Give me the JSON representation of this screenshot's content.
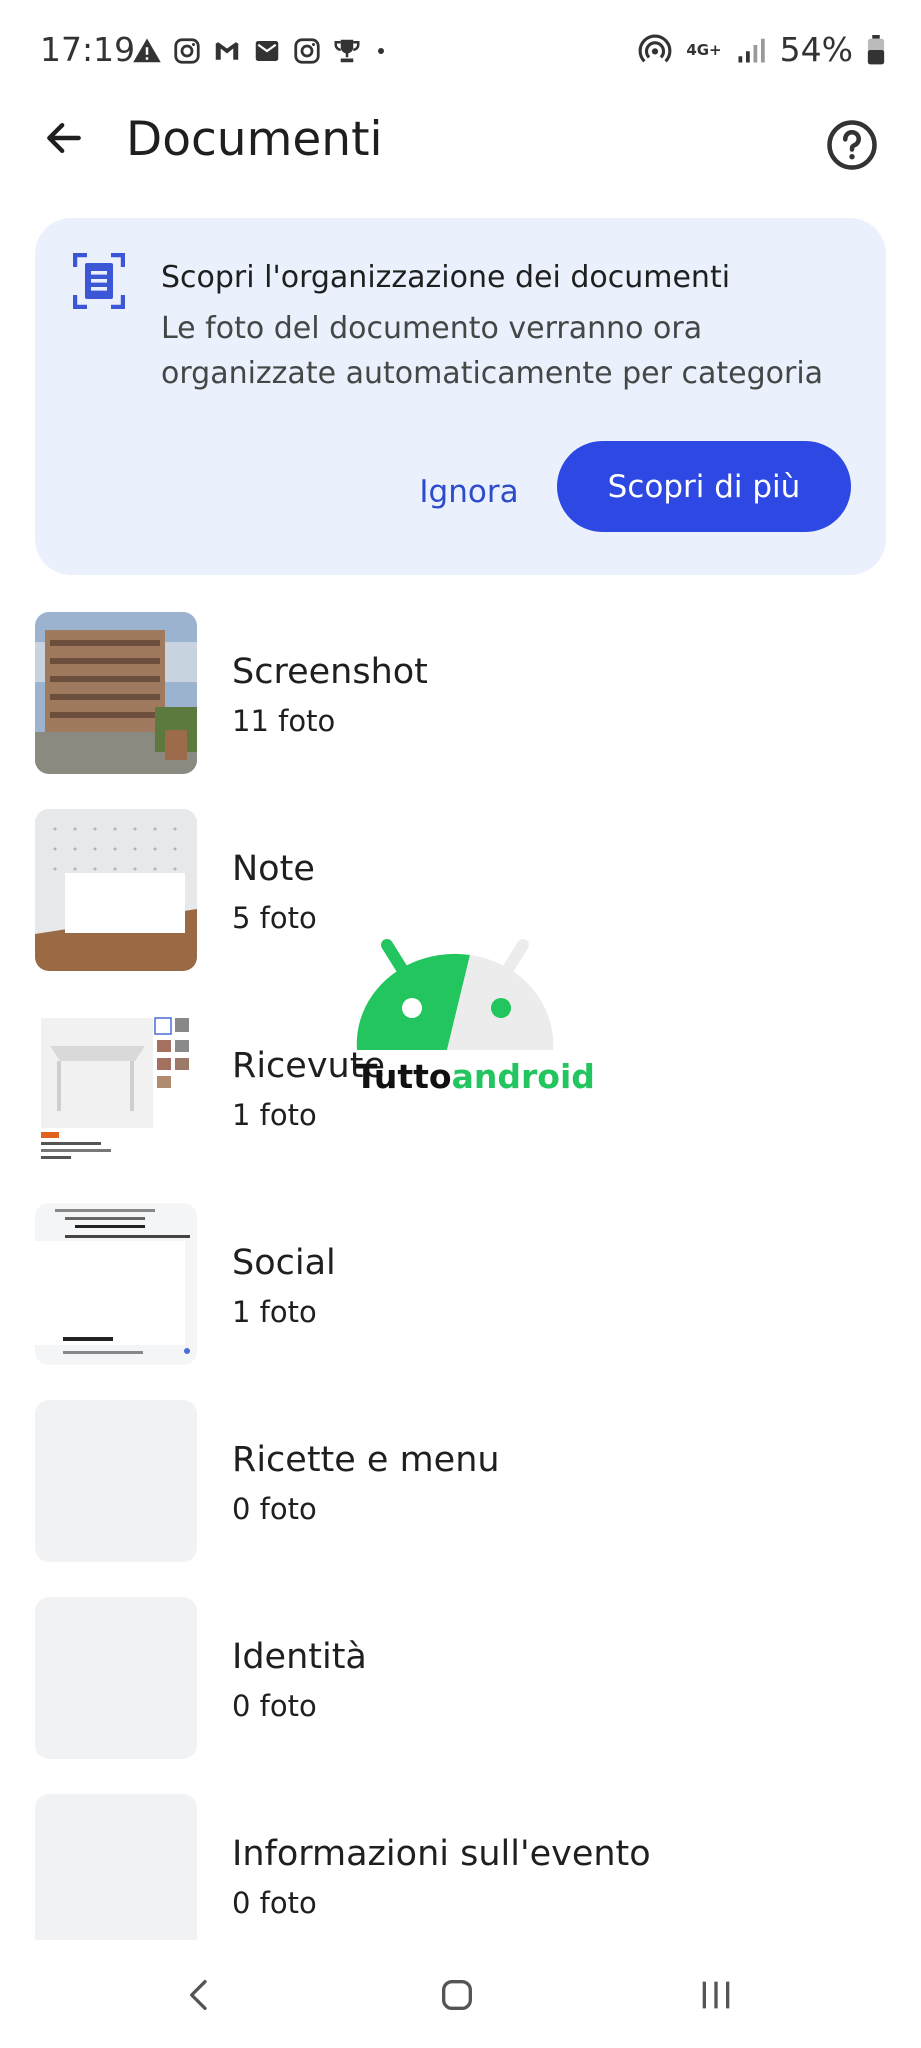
{
  "status_bar": {
    "time": "17:19",
    "network": "4G+",
    "battery": "54%",
    "notification_icons": [
      "warning-icon",
      "instagram-icon",
      "gmail-icon",
      "mail-icon",
      "instagram-icon",
      "trophy-icon",
      "dot-icon"
    ]
  },
  "header": {
    "title": "Documenti",
    "back_icon": "arrow-back-icon",
    "help_icon": "help-icon"
  },
  "info_card": {
    "icon": "document-scan-icon",
    "title": "Scopri l'organizzazione dei documenti",
    "body": "Le foto del documento verranno ora organizzate automaticamente per categoria",
    "ignore_label": "Ignora",
    "learn_more_label": "Scopri di più",
    "accent_color": "#2e48e3",
    "background_color": "#eaf0fc"
  },
  "categories": [
    {
      "title": "Screenshot",
      "count": "11 foto"
    },
    {
      "title": "Note",
      "count": "5 foto"
    },
    {
      "title": "Ricevute",
      "count": "1 foto"
    },
    {
      "title": "Social",
      "count": "1 foto"
    },
    {
      "title": "Ricette e menu",
      "count": "0 foto"
    },
    {
      "title": "Identità",
      "count": "0 foto"
    },
    {
      "title": "Informazioni sull'evento",
      "count": "0 foto"
    }
  ],
  "watermark": {
    "part1": "Tutto",
    "part2": "android"
  },
  "navigation": {
    "back": "nav-back-icon",
    "home": "nav-home-icon",
    "recents": "nav-recents-icon"
  }
}
